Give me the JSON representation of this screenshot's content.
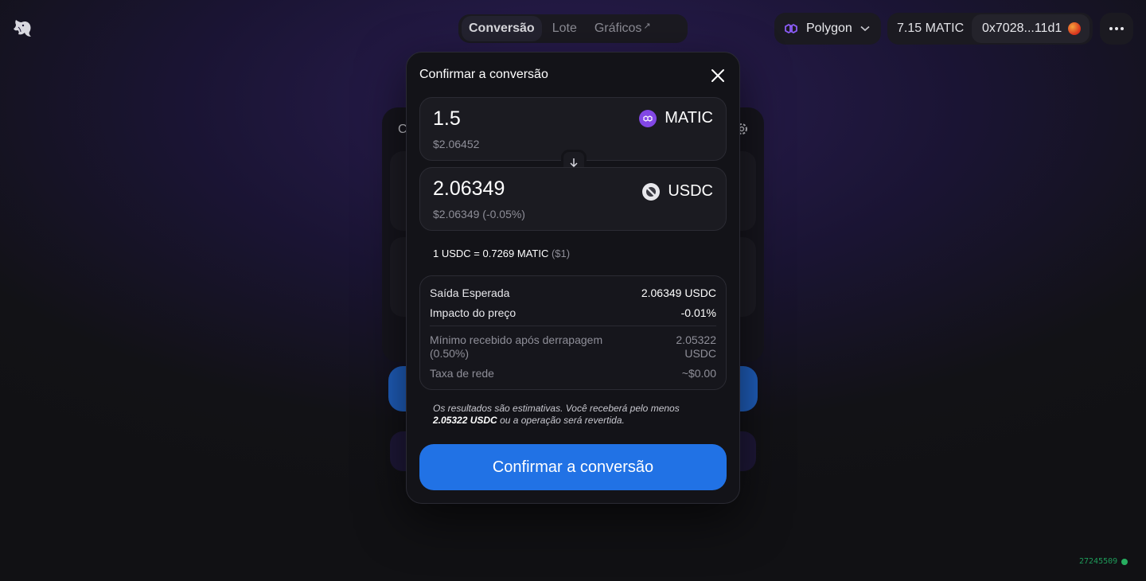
{
  "nav": {
    "tabs": [
      {
        "label": "Conversão",
        "active": true
      },
      {
        "label": "Lote",
        "active": false
      },
      {
        "label": "Gráficos",
        "active": false,
        "external": "↗"
      }
    ]
  },
  "header": {
    "network": "Polygon",
    "balance": "7.15 MATIC",
    "address": "0x7028...11d1"
  },
  "background_card": {
    "title_initial": "C"
  },
  "modal": {
    "title": "Confirmar a conversão",
    "input": {
      "amount": "1.5",
      "usd": "$2.06452",
      "symbol": "MATIC"
    },
    "output": {
      "amount": "2.06349",
      "usd": "$2.06349 (-0.05%)",
      "symbol": "USDC"
    },
    "rate": {
      "text": "1 USDC = 0.7269 MATIC",
      "usd": "($1)"
    },
    "details": {
      "expected_label": "Saída Esperada",
      "expected_value": "2.06349 USDC",
      "impact_label": "Impacto do preço",
      "impact_value": "-0.01%",
      "min_label": "Mínimo recebido após derrapagem (0.50%)",
      "min_value": "2.05322 USDC",
      "fee_label": "Taxa de rede",
      "fee_value": "~$0.00"
    },
    "note": {
      "prefix": "Os resultados são estimativas. Você receberá pelo menos",
      "amount": "2.05322 USDC",
      "suffix": "ou a operação será revertida."
    },
    "confirm_label": "Confirmar a conversão"
  },
  "status": {
    "block": "27245509"
  },
  "colors": {
    "accent": "#2172e5",
    "matic": "#8247e5",
    "status": "#27ae60"
  },
  "icons": [
    "unicorn-logo-icon",
    "polygon-icon",
    "chevron-down-icon",
    "more-icon",
    "close-icon",
    "arrow-down-icon",
    "matic-icon",
    "usdc-icon",
    "gear-icon"
  ]
}
